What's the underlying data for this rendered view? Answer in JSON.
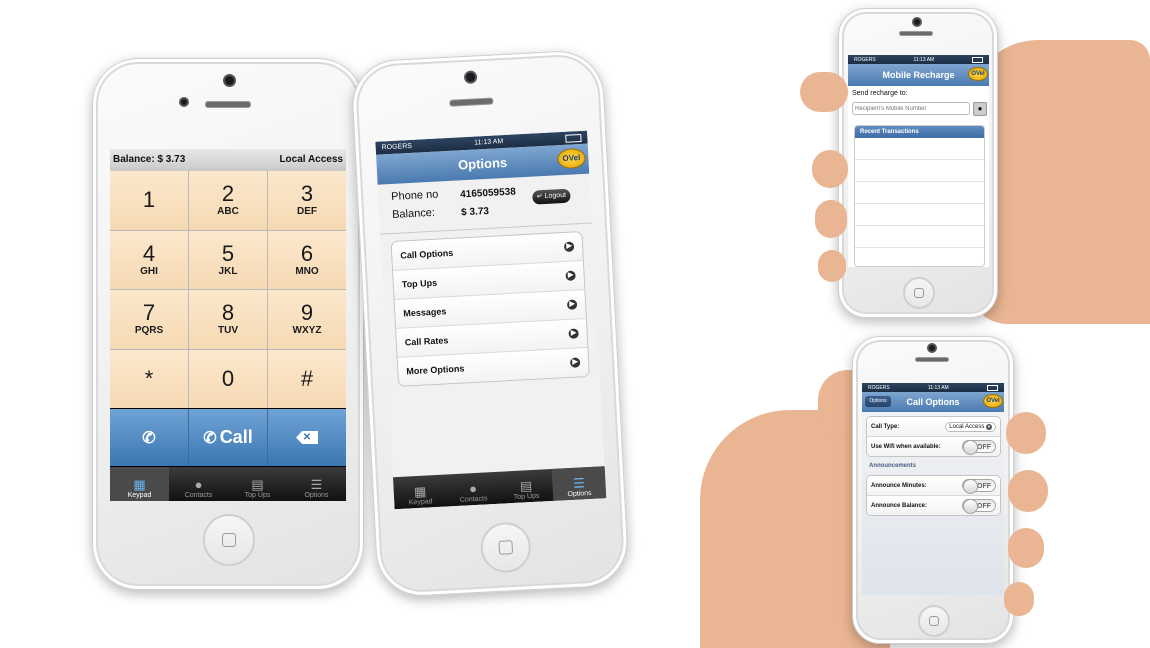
{
  "keypad_phone": {
    "balance_label": "Balance: $ 3.73",
    "access_label": "Local Access",
    "keys": [
      {
        "digit": "1",
        "letters": ""
      },
      {
        "digit": "2",
        "letters": "ABC"
      },
      {
        "digit": "3",
        "letters": "DEF"
      },
      {
        "digit": "4",
        "letters": "GHI"
      },
      {
        "digit": "5",
        "letters": "JKL"
      },
      {
        "digit": "6",
        "letters": "MNO"
      },
      {
        "digit": "7",
        "letters": "PQRS"
      },
      {
        "digit": "8",
        "letters": "TUV"
      },
      {
        "digit": "9",
        "letters": "WXYZ"
      },
      {
        "digit": "*",
        "letters": ""
      },
      {
        "digit": "0",
        "letters": ""
      },
      {
        "digit": "#",
        "letters": ""
      }
    ],
    "call_label": "Call",
    "tabs": [
      "Keypad",
      "Contacts",
      "Top Ups",
      "Options"
    ],
    "active_tab": "Keypad"
  },
  "options_phone": {
    "carrier": "ROGERS",
    "time": "11:13 AM",
    "title": "Options",
    "logo_text": "OVel",
    "phone_label": "Phone no",
    "phone_value": "4165059538",
    "balance_label": "Balance:",
    "balance_value": "$ 3.73",
    "logout_label": "Logout",
    "menu_items": [
      "Call Options",
      "Top Ups",
      "Messages",
      "Call Rates",
      "More Options"
    ],
    "tabs": [
      "Keypad",
      "Contacts",
      "Top Ups",
      "Options"
    ],
    "active_tab": "Options"
  },
  "recharge_phone": {
    "carrier": "ROGERS",
    "time": "11:13 AM",
    "title": "Mobile Recharge",
    "logo_text": "OVel",
    "send_label": "Send recharge to:",
    "recipient_placeholder": "Recipient's Mobile Number",
    "recent_header": "Recent Transactions"
  },
  "calloptions_phone": {
    "carrier": "ROGERS",
    "time": "11:13 AM",
    "back_label": "Options",
    "title": "Call Options",
    "logo_text": "OVel",
    "call_type_label": "Call Type:",
    "call_type_value": "Local Access",
    "wifi_label": "Use Wifi when available:",
    "wifi_state": "OFF",
    "announcements_header": "Announcements",
    "announce_minutes_label": "Announce Minutes:",
    "announce_minutes_state": "OFF",
    "announce_balance_label": "Announce Balance:",
    "announce_balance_state": "OFF"
  }
}
